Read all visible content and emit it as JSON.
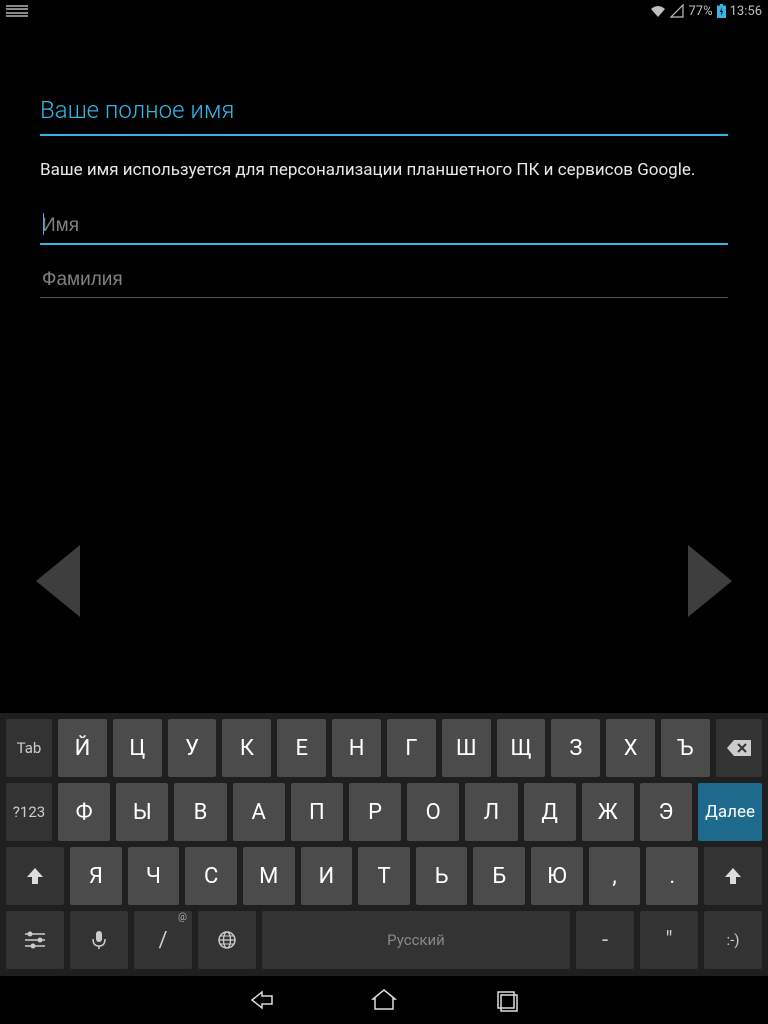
{
  "statusbar": {
    "battery": "77%",
    "time": "13:56"
  },
  "form": {
    "title": "Ваше полное имя",
    "description": "Ваше имя используется для персонализации планшетного ПК и сервисов Google.",
    "first_name_placeholder": "Имя",
    "first_name_value": "",
    "last_name_placeholder": "Фамилия",
    "last_name_value": ""
  },
  "keyboard": {
    "tab": "Tab",
    "symnum": "?123",
    "next": "Далее",
    "space": "Русский",
    "slash": "/",
    "slash_sup": "@",
    "dash": "-",
    "smile": ":-)",
    "comma": ",",
    "period": ".",
    "row1": [
      "Й",
      "Ц",
      "У",
      "К",
      "Е",
      "Н",
      "Г",
      "Ш",
      "Щ",
      "З",
      "Х",
      "Ъ"
    ],
    "row2": [
      "Ф",
      "Ы",
      "В",
      "А",
      "П",
      "Р",
      "О",
      "Л",
      "Д",
      "Ж",
      "Э"
    ],
    "row3": [
      "Я",
      "Ч",
      "С",
      "М",
      "И",
      "Т",
      "Ь",
      "Б",
      "Ю"
    ]
  }
}
